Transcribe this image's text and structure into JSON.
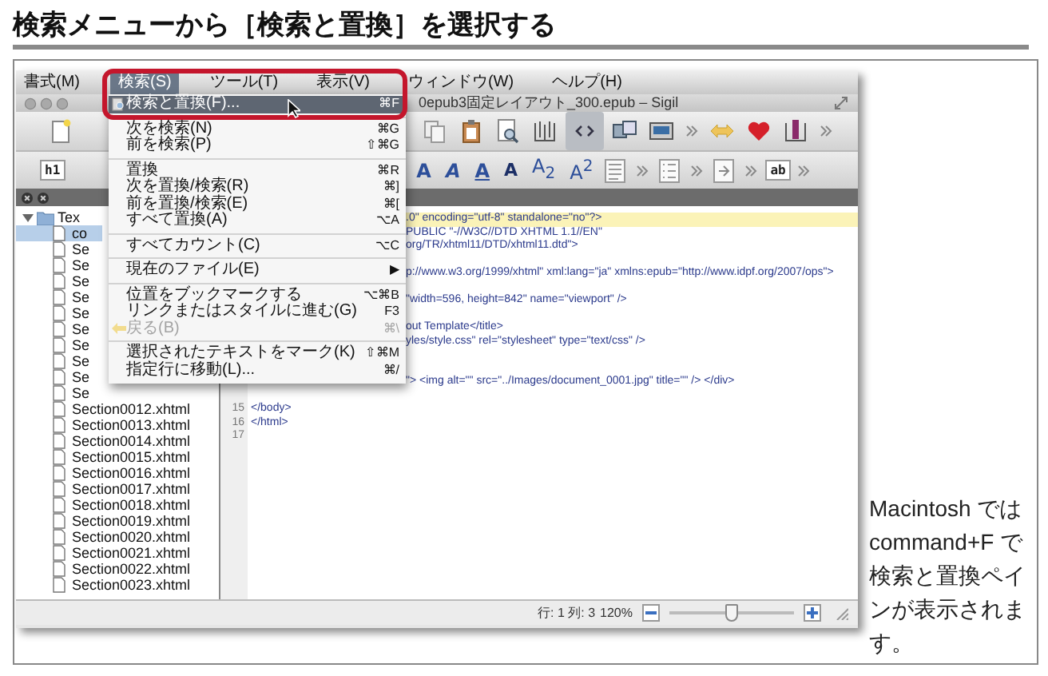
{
  "heading": "検索メニューから［検索と置換］を選択する",
  "menubar": [
    {
      "label": "書式(M)",
      "selected": false
    },
    {
      "label": "検索(S)",
      "selected": true
    },
    {
      "label": "ツール(T)",
      "selected": false
    },
    {
      "label": "表示(V)",
      "selected": false
    },
    {
      "label": "ウィンドウ(W)",
      "selected": false
    },
    {
      "label": "ヘルプ(H)",
      "selected": false
    }
  ],
  "window": {
    "title": "0epub3固定レイアウト_300.epub – Sigil"
  },
  "main_toolbar": [
    {
      "kind": "document",
      "selected": false
    },
    {
      "kind": "copy",
      "selected": false
    },
    {
      "kind": "paste",
      "selected": false
    },
    {
      "kind": "preview",
      "selected": false
    },
    {
      "kind": "book",
      "selected": false
    },
    {
      "kind": "code",
      "selected": true
    },
    {
      "kind": "split",
      "selected": false
    },
    {
      "kind": "image",
      "selected": false
    },
    {
      "kind": "chevron",
      "selected": false
    },
    {
      "kind": "arrow",
      "selected": false
    },
    {
      "kind": "heart",
      "selected": false
    },
    {
      "kind": "metadata",
      "selected": false
    },
    {
      "kind": "chevron",
      "selected": false
    }
  ],
  "format_toolbar": [
    {
      "kind": "box",
      "label": "h1"
    },
    {
      "kind": "bold",
      "label": "A"
    },
    {
      "kind": "italic",
      "label": "A"
    },
    {
      "kind": "underline",
      "label": "A"
    },
    {
      "kind": "strike",
      "label": "A"
    },
    {
      "kind": "plain",
      "label": "A$_{2}$"
    },
    {
      "kind": "plain",
      "label": "A$^{2}$"
    },
    {
      "kind": "paragraph"
    },
    {
      "kind": "chevron"
    },
    {
      "kind": "list"
    },
    {
      "kind": "chevron"
    },
    {
      "kind": "indent"
    },
    {
      "kind": "chevron"
    },
    {
      "kind": "box",
      "label": "ab"
    },
    {
      "kind": "chevron"
    }
  ],
  "menu": [
    [
      {
        "label": "検索と置換(F)...",
        "shortcut": "⌘F",
        "kind": "search",
        "selected": true,
        "disabled": false
      }
    ],
    [
      {
        "label": "次を検索(N)",
        "shortcut": "⌘G",
        "kind": "plain",
        "selected": false,
        "disabled": false
      },
      {
        "label": "前を検索(P)",
        "shortcut": "⇧⌘G",
        "kind": "plain",
        "selected": false,
        "disabled": false
      }
    ],
    [
      {
        "label": "置換",
        "shortcut": "⌘R",
        "kind": "plain",
        "selected": false,
        "disabled": false
      },
      {
        "label": "次を置換/検索(R)",
        "shortcut": "⌘]",
        "kind": "plain",
        "selected": false,
        "disabled": false
      },
      {
        "label": "前を置換/検索(E)",
        "shortcut": "⌘[",
        "kind": "plain",
        "selected": false,
        "disabled": false
      },
      {
        "label": "すべて置換(A)",
        "shortcut": "⌥A",
        "kind": "plain",
        "selected": false,
        "disabled": false
      }
    ],
    [
      {
        "label": "すべてカウント(C)",
        "shortcut": "⌥C",
        "kind": "plain",
        "selected": false,
        "disabled": false
      }
    ],
    [
      {
        "label": "現在のファイル(E)",
        "shortcut": "▶",
        "kind": "plain",
        "selected": false,
        "disabled": false
      }
    ],
    [
      {
        "label": "位置をブックマークする",
        "shortcut": "⌥⌘B",
        "kind": "plain",
        "selected": false,
        "disabled": false
      },
      {
        "label": "リンクまたはスタイルに進む(G)",
        "shortcut": "F3",
        "kind": "plain",
        "selected": false,
        "disabled": false
      },
      {
        "label": "戻る(B)",
        "shortcut": "⌘\\",
        "kind": "back",
        "selected": false,
        "disabled": true
      }
    ],
    [
      {
        "label": "選択されたテキストをマーク(K)",
        "shortcut": "⇧⌘M",
        "kind": "plain",
        "selected": false,
        "disabled": false
      },
      {
        "label": "指定行に移動(L)...",
        "shortcut": "⌘/",
        "kind": "plain",
        "selected": false,
        "disabled": false
      }
    ]
  ],
  "file_tree": {
    "name": "Tex",
    "expanded": true,
    "children": [
      {
        "name": "co",
        "selected": true
      },
      {
        "name": "Se",
        "selected": false
      },
      {
        "name": "Se",
        "selected": false
      },
      {
        "name": "Se",
        "selected": false
      },
      {
        "name": "Se",
        "selected": false
      },
      {
        "name": "Se",
        "selected": false
      },
      {
        "name": "Se",
        "selected": false
      },
      {
        "name": "Se",
        "selected": false
      },
      {
        "name": "Se",
        "selected": false
      },
      {
        "name": "Se",
        "selected": false
      },
      {
        "name": "Se",
        "selected": false
      },
      {
        "name": "Section0012.xhtml",
        "selected": false
      },
      {
        "name": "Section0013.xhtml",
        "selected": false
      },
      {
        "name": "Section0014.xhtml",
        "selected": false
      },
      {
        "name": "Section0015.xhtml",
        "selected": false
      },
      {
        "name": "Section0016.xhtml",
        "selected": false
      },
      {
        "name": "Section0017.xhtml",
        "selected": false
      },
      {
        "name": "Section0018.xhtml",
        "selected": false
      },
      {
        "name": "Section0019.xhtml",
        "selected": false
      },
      {
        "name": "Section0020.xhtml",
        "selected": false
      },
      {
        "name": "Section0021.xhtml",
        "selected": false
      },
      {
        "name": "Section0022.xhtml",
        "selected": false
      },
      {
        "name": "Section0023.xhtml",
        "selected": false
      }
    ]
  },
  "code_lines": [
    {
      "text": ".0\" encoding=\"utf-8\" standalone=\"no\"?>",
      "covered": true,
      "current": true
    },
    {
      "text": "PUBLIC \"-//W3C//DTD XHTML 1.1//EN\"",
      "covered": true,
      "current": false
    },
    {
      "text": "org/TR/xhtml11/DTD/xhtml11.dtd\">",
      "covered": true,
      "current": false
    },
    {
      "current": false
    },
    {
      "text": "p://www.w3.org/1999/xhtml\" xml:lang=\"ja\" xmlns:epub=\"http://www.idpf.org/2007/ops\">",
      "covered": true,
      "current": false
    },
    {
      "current": false
    },
    {
      "text": "\"width=596, height=842\" name=\"viewport\" />",
      "covered": true,
      "current": false
    },
    {
      "current": false
    },
    {
      "text": "out Template</title>",
      "covered": true,
      "current": false
    },
    {
      "text": "yles/style.css\" rel=\"stylesheet\" type=\"text/css\" />",
      "covered": true,
      "current": false
    },
    {
      "current": false
    },
    {
      "current": false
    },
    {
      "text": "\"> <img alt=\"\" src=\"../Images/document_0001.jpg\" title=\"\" /> </div>",
      "covered": true,
      "current": false
    },
    {
      "current": false
    },
    {
      "number": "15",
      "text": "</body>",
      "covered": false,
      "current": false
    },
    {
      "number": "16",
      "text": "</html>",
      "covered": false,
      "current": false
    },
    {
      "number": "17",
      "current": false
    }
  ],
  "status": {
    "position": "行: 1 列: 3",
    "zoom": "120%",
    "level": 0.5
  },
  "caption": "Macintosh では command+F で検索と置換ペインが表示されます。"
}
